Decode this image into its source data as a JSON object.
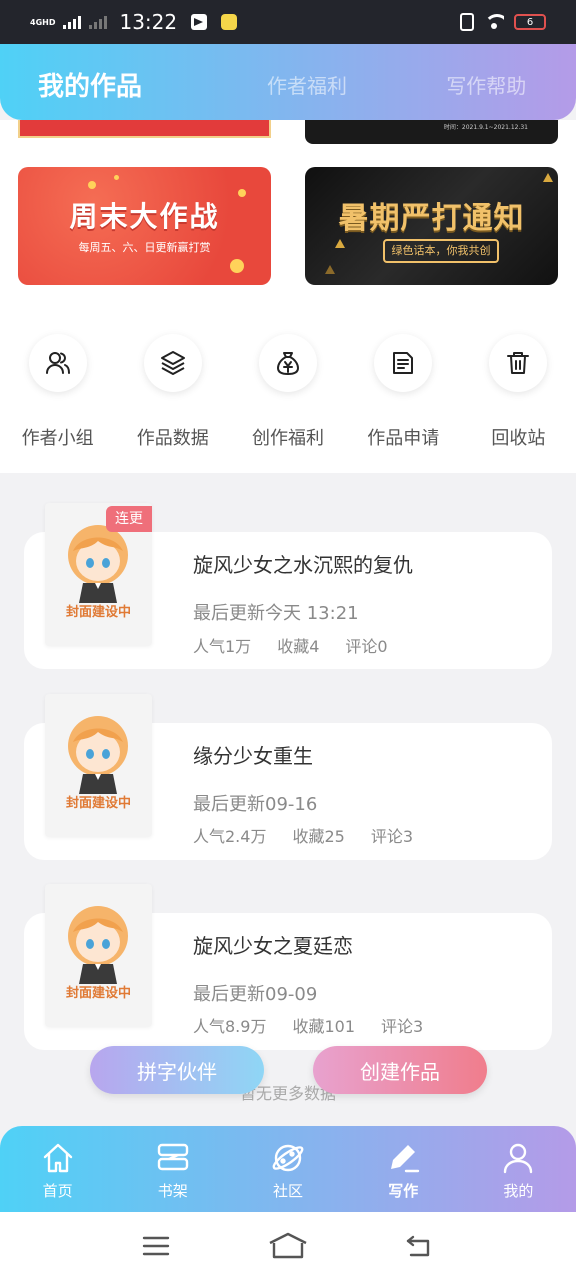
{
  "status_bar": {
    "network": "4GHD",
    "time": "13:22",
    "battery": "6"
  },
  "top_tabs": [
    {
      "label": "我的作品",
      "active": true
    },
    {
      "label": "作者福利",
      "active": false
    },
    {
      "label": "写作帮助",
      "active": false
    }
  ],
  "banners": {
    "top_right_caption": "时间：2021.9.1~2021.12.31",
    "weekend": {
      "title": "周末大作战",
      "subtitle": "每周五、六、日更新赢打赏"
    },
    "summer": {
      "title": "暑期严打通知",
      "subtitle": "绿色话本，你我共创"
    }
  },
  "quick_actions": [
    {
      "label": "作者小组",
      "icon": "users-icon"
    },
    {
      "label": "作品数据",
      "icon": "layers-icon"
    },
    {
      "label": "创作福利",
      "icon": "money-bag-icon"
    },
    {
      "label": "作品申请",
      "icon": "document-icon"
    },
    {
      "label": "回收站",
      "icon": "trash-icon"
    }
  ],
  "works": [
    {
      "title": "旋风少女之水沉熙的复仇",
      "updated": "最后更新今天 13:21",
      "popularity": "人气1万",
      "favorites": "收藏4",
      "comments": "评论0",
      "cover_text": "封面建设中",
      "badge": "连更"
    },
    {
      "title": "缘分少女重生",
      "updated": "最后更新09-16",
      "popularity": "人气2.4万",
      "favorites": "收藏25",
      "comments": "评论3",
      "cover_text": "封面建设中"
    },
    {
      "title": "旋风少女之夏廷恋",
      "updated": "最后更新09-09",
      "popularity": "人气8.9万",
      "favorites": "收藏101",
      "comments": "评论3",
      "cover_text": "封面建设中"
    }
  ],
  "no_more_text": "暂无更多数据",
  "fab": {
    "partner": "拼字伙伴",
    "create": "创建作品"
  },
  "bottom_nav": [
    {
      "label": "首页",
      "icon": "home-icon",
      "active": false
    },
    {
      "label": "书架",
      "icon": "bookshelf-icon",
      "active": false
    },
    {
      "label": "社区",
      "icon": "planet-icon",
      "active": false
    },
    {
      "label": "写作",
      "icon": "pen-icon",
      "active": true
    },
    {
      "label": "我的",
      "icon": "user-icon",
      "active": false
    }
  ],
  "colors": {
    "gradient_start": "#4fd1f6",
    "gradient_end": "#b49be8",
    "badge": "#ef6f7a",
    "cover_text": "#e07a35"
  }
}
